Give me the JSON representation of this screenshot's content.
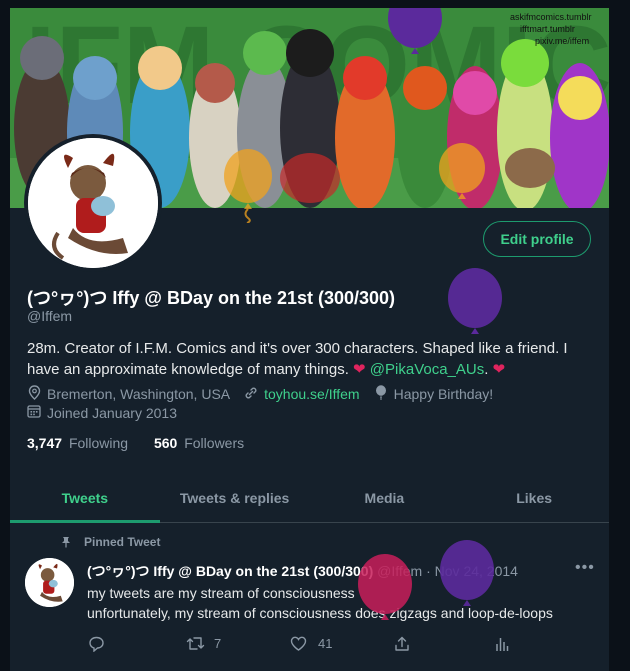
{
  "banner": {
    "title_text": "IFM COMICS",
    "credits": [
      "askifmcomics.tumblr",
      "ifftmart.tumblr",
      "pixiv.me/iffem"
    ]
  },
  "profile": {
    "name": "(つ°ヮ°)つ Iffy @ BDay on the 21st (300/300)",
    "handle": "@Iffem",
    "edit_label": "Edit profile",
    "bio_text": "28m. Creator of I.F.M. Comics and it's over 300 characters. Shaped like a friend. I have an approximate knowledge of many things. ",
    "bio_heart1": "❤",
    "bio_link": "@PikaVoca_AUs",
    "bio_end": ". ",
    "bio_heart2": "❤",
    "location": "Bremerton, Washington, USA",
    "website": "toyhou.se/Iffem",
    "birthday": "Happy Birthday!",
    "joined": "Joined January 2013",
    "following_count": "3,747",
    "following_label": "Following",
    "followers_count": "560",
    "followers_label": "Followers"
  },
  "tabs": [
    "Tweets",
    "Tweets & replies",
    "Media",
    "Likes"
  ],
  "pinned_tweet": {
    "pinned_label": "Pinned Tweet",
    "name": "(つ°ヮ°)つ Iffy @ BDay on the 21st (300/300)",
    "handle_date": "@Iffem · Nov 24, 2014",
    "line1": "my tweets are my stream of consciousness",
    "line2": "unfortunately, my stream of consciousness does zigzags and loop-de-loops",
    "retweets": "7",
    "likes": "41"
  },
  "colors": {
    "accent": "#1d9b6e",
    "background": "#15202b",
    "heart": "#e0245e",
    "balloon_purple": "#5b2a9c",
    "balloon_pink": "#c81e5a",
    "balloon_orange": "#f0a21e"
  }
}
